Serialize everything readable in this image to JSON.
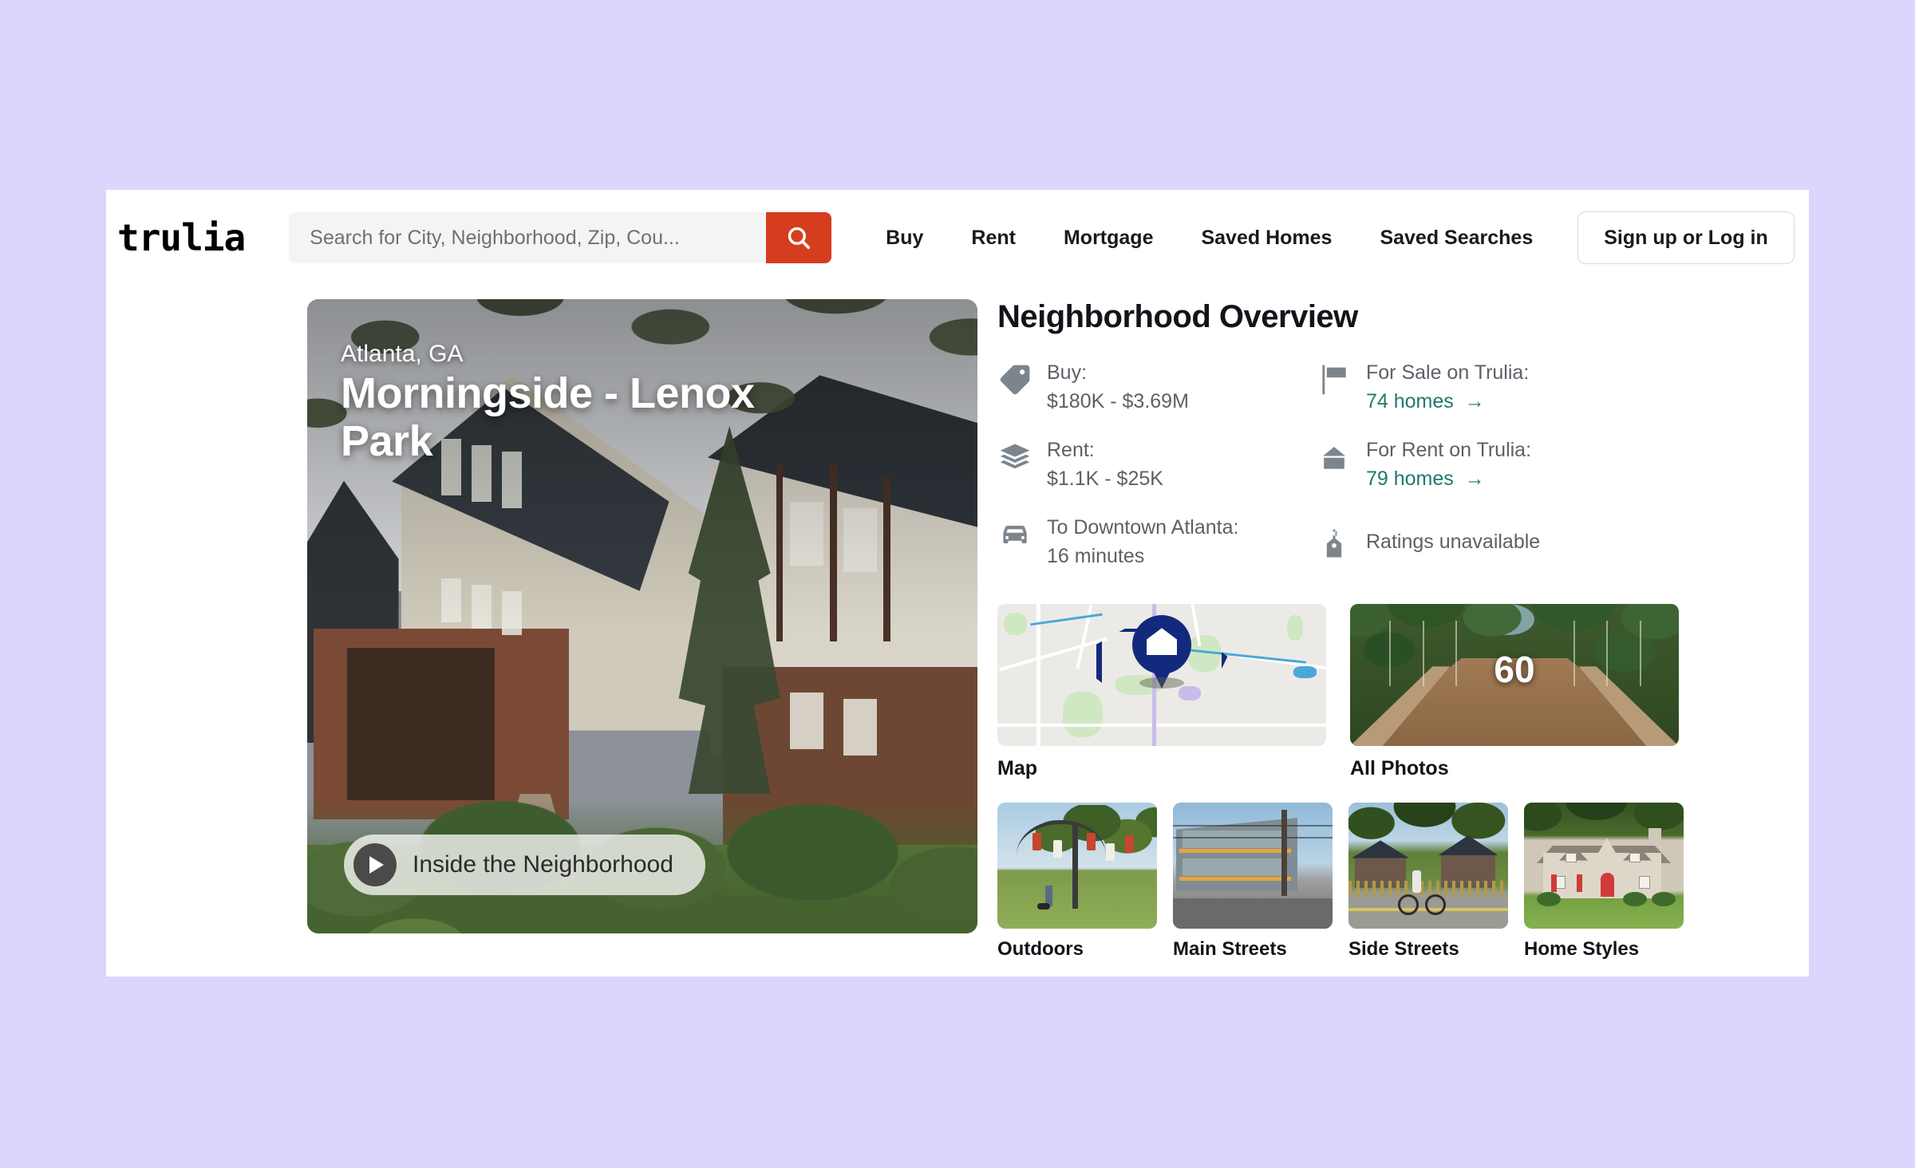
{
  "header": {
    "logo": "trulia",
    "search": {
      "placeholder": "Search for City, Neighborhood, Zip, Cou...",
      "value": "",
      "button_icon": "search-icon"
    },
    "nav": [
      {
        "label": "Buy"
      },
      {
        "label": "Rent"
      },
      {
        "label": "Mortgage"
      },
      {
        "label": "Saved Homes"
      },
      {
        "label": "Saved Searches"
      }
    ],
    "auth_button": "Sign up or Log in"
  },
  "hero": {
    "city": "Atlanta, GA",
    "title": "Morningside - Lenox Park",
    "video_label": "Inside the Neighborhood",
    "play_icon": "play-icon"
  },
  "overview": {
    "title": "Neighborhood Overview",
    "stats_left": [
      {
        "icon": "price-tag-icon",
        "label": "Buy:",
        "value": "$180K - $3.69M"
      },
      {
        "icon": "money-stack-icon",
        "label": "Rent:",
        "value": "$1.1K - $25K"
      },
      {
        "icon": "car-icon",
        "label": "To Downtown Atlanta:",
        "value": "16 minutes"
      }
    ],
    "stats_right": [
      {
        "icon": "flag-icon",
        "label": "For Sale on Trulia:",
        "link": "74 homes",
        "arrow": "→"
      },
      {
        "icon": "for-rent-icon",
        "label": "For Rent on Trulia:",
        "link": "79 homes",
        "arrow": "→"
      }
    ],
    "ratings": {
      "icon": "school-icon",
      "label": "Ratings unavailable"
    }
  },
  "media": {
    "map_tile": {
      "caption": "Map"
    },
    "photos_tile": {
      "caption": "All Photos",
      "count": "60"
    },
    "thumbnails": [
      {
        "caption": "Outdoors"
      },
      {
        "caption": "Main Streets"
      },
      {
        "caption": "Side Streets"
      },
      {
        "caption": "Home Styles"
      }
    ]
  },
  "colors": {
    "page_background": "#ddd6fc",
    "brand_red": "#d63d1e",
    "link_green": "#1d7a6c",
    "map_navy": "#13297e",
    "text_dark": "#11151a",
    "text_muted": "#5b6168"
  }
}
